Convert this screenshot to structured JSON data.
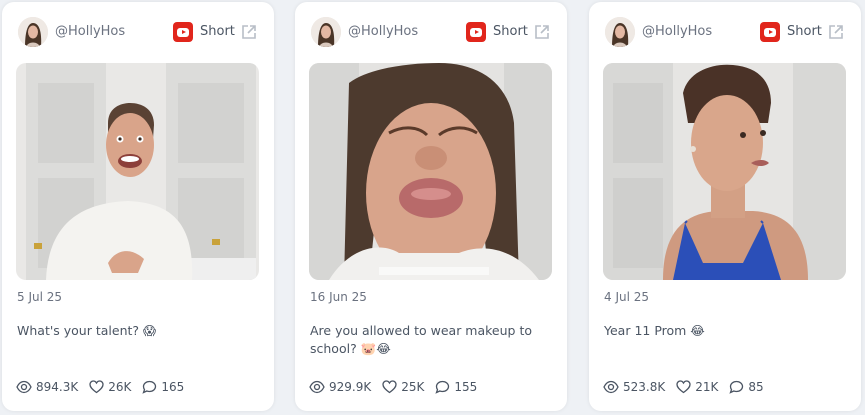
{
  "cards": [
    {
      "handle": "@HollyHos",
      "platform_label": "Short",
      "date": "5 Jul 25",
      "caption": "What's your talent? 😱",
      "views": "894.3K",
      "likes": "26K",
      "comments": "165"
    },
    {
      "handle": "@HollyHos",
      "platform_label": "Short",
      "date": "16 Jun 25",
      "caption": "Are you allowed to wear makeup to school? 🐷😂",
      "views": "929.9K",
      "likes": "25K",
      "comments": "155"
    },
    {
      "handle": "@HollyHos",
      "platform_label": "Short",
      "date": "4 Jul 25",
      "caption": "Year 11 Prom 😂",
      "views": "523.8K",
      "likes": "21K",
      "comments": "85"
    }
  ],
  "icons": {
    "platform": "youtube-icon",
    "open": "external-link-icon",
    "views": "eye-icon",
    "likes": "heart-icon",
    "comments": "comment-icon"
  },
  "colors": {
    "youtube_red": "#e1261c",
    "card_bg": "#ffffff",
    "page_bg": "#eef1f5"
  }
}
